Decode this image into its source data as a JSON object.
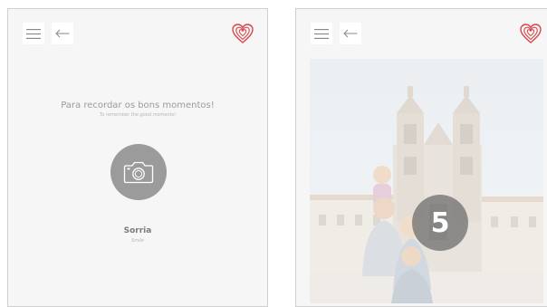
{
  "left_screen": {
    "icons": {
      "menu": "hamburger-menu-icon",
      "back": "arrow-left-icon",
      "logo": "heart-logo-icon",
      "camera": "camera-icon"
    },
    "tagline": "Para recordar os bons momentos!",
    "tagline_en": "To remember the good moments!",
    "smile_label": "Sorria",
    "smile_label_en": "Smile"
  },
  "right_screen": {
    "icons": {
      "menu": "hamburger-menu-icon",
      "back": "arrow-left-icon",
      "logo": "heart-logo-icon"
    },
    "countdown": "5"
  },
  "colors": {
    "accent": "#d8454b",
    "panel_bg": "#f6f6f6",
    "camera_circle": "#9b9b9b",
    "text_gray": "#9a9a9a"
  }
}
